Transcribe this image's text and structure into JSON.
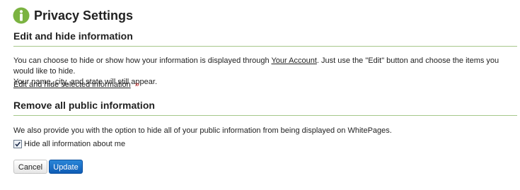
{
  "header": {
    "title": "Privacy Settings",
    "icon": "info-icon",
    "icon_color": "#7bb341"
  },
  "section_edit": {
    "heading": "Edit and hide information",
    "text_before_link": "You can choose to hide or show how your information is displayed through ",
    "account_link": "Your Account",
    "text_after_link": ". Just use the \"Edit\" button and choose the items you would like to hide.",
    "text_line2": "Your name, city, and state will still appear.",
    "edit_link": "Edit and hide selected information",
    "edit_link_arrow": "»"
  },
  "section_remove": {
    "heading": "Remove all public information",
    "text": "We also provide you with the option to hide all of your public information from being displayed on WhitePages.",
    "checkbox_label": "Hide all information about me",
    "checkbox_checked": true
  },
  "buttons": {
    "cancel": "Cancel",
    "update": "Update"
  },
  "colors": {
    "rule": "#a6c78a",
    "primary_button": "#1a6fc8",
    "arrow": "#cc2222"
  }
}
